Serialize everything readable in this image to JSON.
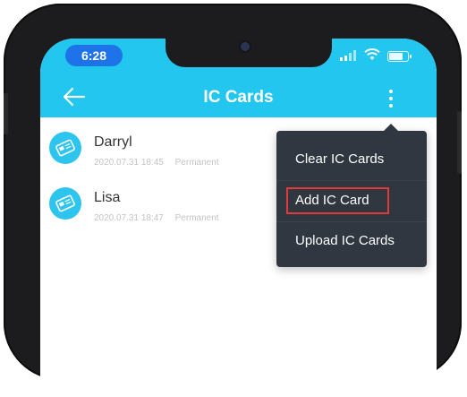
{
  "status_bar": {
    "time": "6:28"
  },
  "header": {
    "title": "IC Cards"
  },
  "cards": [
    {
      "name": "Darryl",
      "date": "2020.07.31 18:45",
      "type": "Permanent"
    },
    {
      "name": "Lisa",
      "date": "2020.07.31 18:47",
      "type": "Permanent"
    }
  ],
  "menu": {
    "items": [
      {
        "label": "Clear IC Cards"
      },
      {
        "label": "Add IC Card",
        "highlighted": true
      },
      {
        "label": "Upload IC Cards"
      }
    ]
  },
  "colors": {
    "header_bg": "#22c6ee",
    "menu_bg": "#303741",
    "highlight": "#e03a3a",
    "time_pill": "#1e73e8"
  },
  "icons": {
    "back": "arrow-left-icon",
    "more": "more-vertical-icon",
    "card": "ic-card-icon"
  }
}
